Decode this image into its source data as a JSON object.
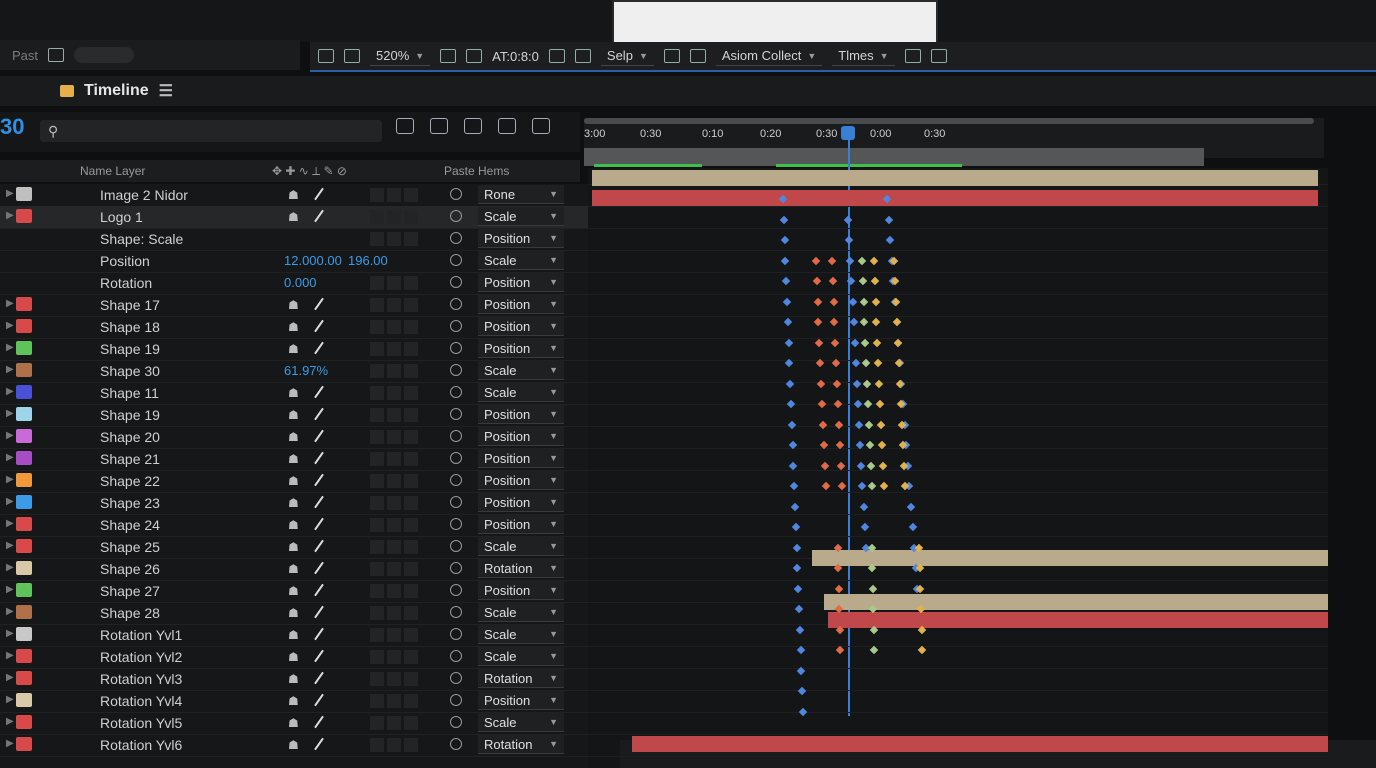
{
  "left_panel": {
    "label": "Past"
  },
  "viewer_toolbar": {
    "zoom": "520%",
    "timecode": "AT:0:8:0",
    "mode": "Selp",
    "collect": "Asiom Collect",
    "times": "Tlmes"
  },
  "timeline": {
    "title": "Timeline",
    "time_readout": "30",
    "search_placeholder": "",
    "col_name": "Name Layer",
    "col_paste": "Paste Hems"
  },
  "ruler_ticks": [
    "3:00",
    "0:30",
    "0:10",
    "0:20",
    "0:30",
    "0:00",
    "0:30"
  ],
  "layers": [
    {
      "name": "Image 2 Nidor",
      "color": "#bfbfbf",
      "prop": "Rone"
    },
    {
      "name": "Logo 1",
      "color": "#d84a4a",
      "prop": "Scale",
      "selected": true
    },
    {
      "name": "Shape: Scale",
      "prop": "Position"
    },
    {
      "name": "Position",
      "prop": "Scale",
      "value1": "12.000.00",
      "value2": "196.00"
    },
    {
      "name": "Rotation",
      "prop": "Position",
      "value1": "0.000"
    },
    {
      "name": "Shape 17",
      "color": "#d84a4a",
      "prop": "Position"
    },
    {
      "name": "Shape 18",
      "color": "#d84a4a",
      "prop": "Position"
    },
    {
      "name": "Shape 19",
      "color": "#5fc25a",
      "prop": "Position"
    },
    {
      "name": "Shape 30",
      "color": "#b0714a",
      "prop": "Scale",
      "value1": "61.97%"
    },
    {
      "name": "Shape 11",
      "color": "#4b50d8",
      "prop": "Scale"
    },
    {
      "name": "Shape 19",
      "color": "#9ed3e8",
      "prop": "Position"
    },
    {
      "name": "Shape 20",
      "color": "#c86ad8",
      "prop": "Position"
    },
    {
      "name": "Shape 21",
      "color": "#a64dc4",
      "prop": "Position"
    },
    {
      "name": "Shape 22",
      "color": "#f0973a",
      "prop": "Position"
    },
    {
      "name": "Shape 23",
      "color": "#3b9be8",
      "prop": "Position"
    },
    {
      "name": "Shape 24",
      "color": "#d84a4a",
      "prop": "Position"
    },
    {
      "name": "Shape 25",
      "color": "#d84a4a",
      "prop": "Scale"
    },
    {
      "name": "Shape 26",
      "color": "#d9c9a8",
      "prop": "Rotation"
    },
    {
      "name": "Shape 27",
      "color": "#5fc25a",
      "prop": "Position"
    },
    {
      "name": "Shape 28",
      "color": "#b0714a",
      "prop": "Scale"
    },
    {
      "name": "Rotation Yvl1",
      "color": "#c8c8c8",
      "prop": "Scale"
    },
    {
      "name": "Rotation Yvl2",
      "color": "#d84a4a",
      "prop": "Scale"
    },
    {
      "name": "Rotation Yvl3",
      "color": "#d84a4a",
      "prop": "Rotation"
    },
    {
      "name": "Rotation Yvl4",
      "color": "#d9c9a8",
      "prop": "Position"
    },
    {
      "name": "Rotation Yvl5",
      "color": "#d84a4a",
      "prop": "Scale"
    },
    {
      "name": "Rotation Yvl6",
      "color": "#d84a4a",
      "prop": "Rotation"
    }
  ],
  "extra_props": [
    "Position",
    "Scale",
    "Scale"
  ],
  "colors": {
    "accent": "#3a7fd6",
    "track_red": "#c0474a",
    "track_tan": "#b9aa8c",
    "kf_blue": "#4f86e0",
    "kf_orange": "#e06b46",
    "kf_yellow": "#e2b24a",
    "kf_green": "#a8c98a"
  }
}
